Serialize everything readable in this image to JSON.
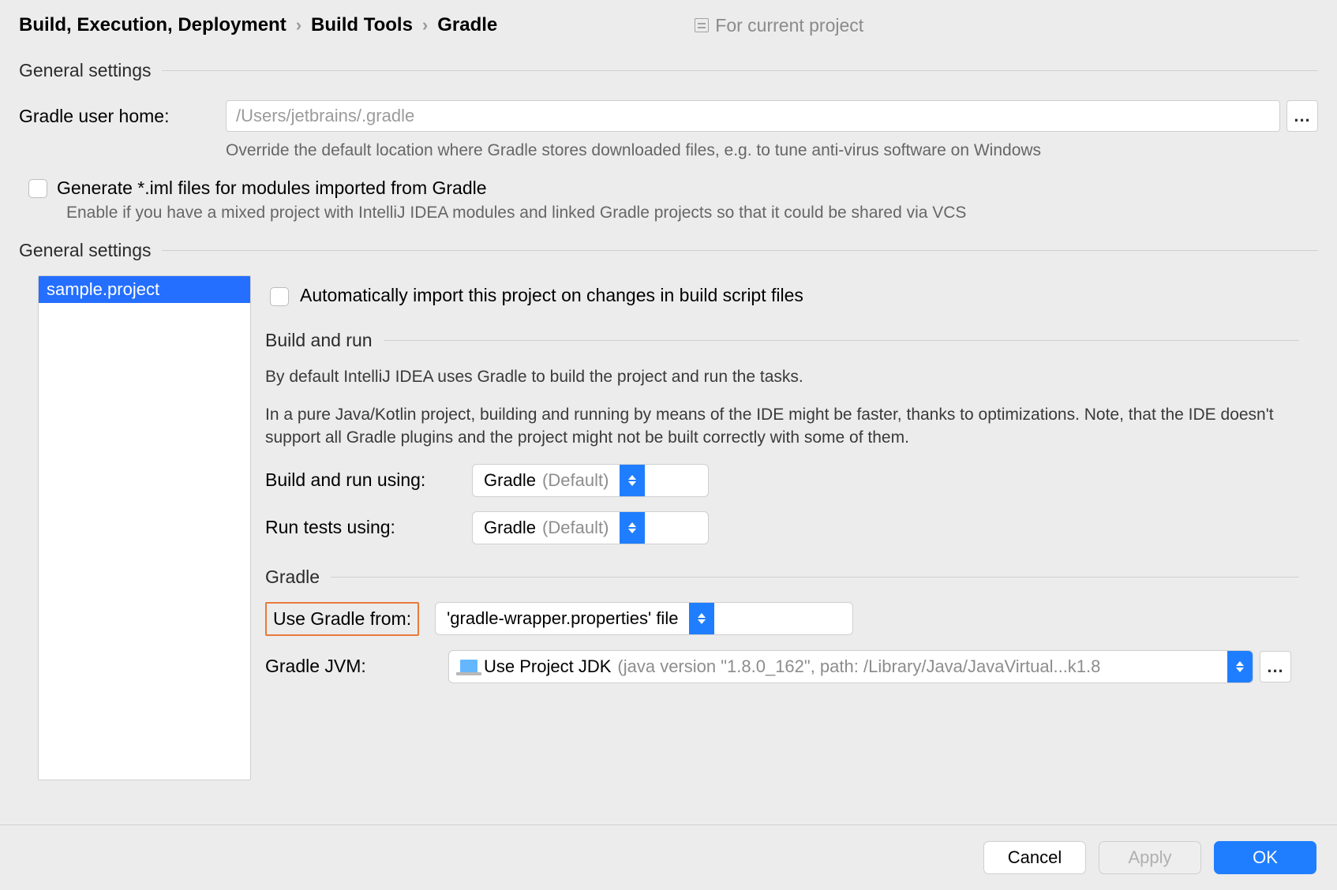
{
  "breadcrumb": {
    "a": "Build, Execution, Deployment",
    "b": "Build Tools",
    "c": "Gradle"
  },
  "scope_label": "For current project",
  "section1": {
    "title": "General settings",
    "gradle_home_label": "Gradle user home:",
    "gradle_home_placeholder": "/Users/jetbrains/.gradle",
    "gradle_home_hint": "Override the default location where Gradle stores downloaded files, e.g. to tune anti-virus software on Windows",
    "generate_iml_label": "Generate *.iml files for modules imported from Gradle",
    "generate_iml_hint": "Enable if you have a mixed project with IntelliJ IDEA modules and linked Gradle projects so that it could be shared via VCS"
  },
  "section2": {
    "title": "General settings",
    "project_name": "sample.project",
    "auto_import_label": "Automatically import this project on changes in build script files",
    "build_run_title": "Build and run",
    "build_run_p1": "By default IntelliJ IDEA uses Gradle to build the project and run the tasks.",
    "build_run_p2": "In a pure Java/Kotlin project, building and running by means of the IDE might be faster, thanks to optimizations. Note, that the IDE doesn't support all Gradle plugins and the project might not be built correctly with some of them.",
    "build_using_label": "Build and run using:",
    "build_using_value": "Gradle",
    "build_using_suffix": "(Default)",
    "tests_using_label": "Run tests using:",
    "tests_using_value": "Gradle",
    "tests_using_suffix": "(Default)",
    "gradle_title": "Gradle",
    "use_gradle_from_label": "Use Gradle from:",
    "use_gradle_from_value": "'gradle-wrapper.properties' file",
    "gradle_jvm_label": "Gradle JVM:",
    "gradle_jvm_value": "Use Project JDK",
    "gradle_jvm_detail": "(java version \"1.8.0_162\", path: /Library/Java/JavaVirtual...k1.8"
  },
  "footer": {
    "cancel": "Cancel",
    "apply": "Apply",
    "ok": "OK"
  },
  "ellipsis": "..."
}
